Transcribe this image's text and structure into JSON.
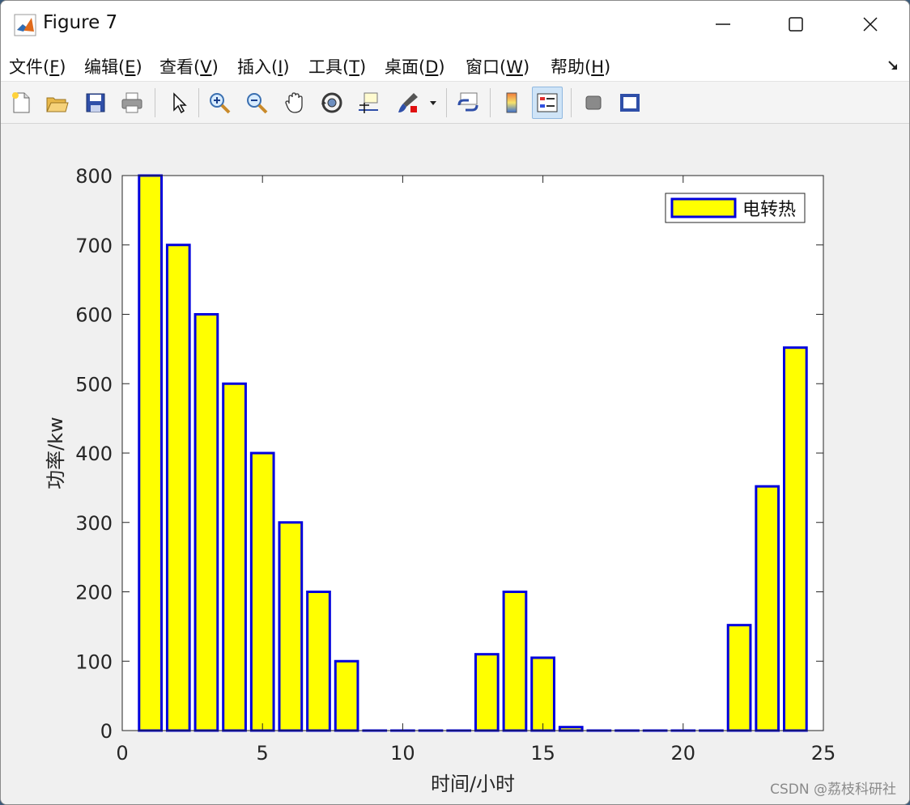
{
  "window": {
    "title": "Figure 7"
  },
  "menu": [
    {
      "pre": "文件(",
      "key": "F",
      "post": ")"
    },
    {
      "pre": "编辑(",
      "key": "E",
      "post": ")"
    },
    {
      "pre": "查看(",
      "key": "V",
      "post": ")"
    },
    {
      "pre": "插入(",
      "key": "I",
      "post": ")"
    },
    {
      "pre": "工具(",
      "key": "T",
      "post": ")"
    },
    {
      "pre": "桌面(",
      "key": "D",
      "post": ")"
    },
    {
      "pre": "窗口(",
      "key": "W",
      "post": ")"
    },
    {
      "pre": "帮助(",
      "key": "H",
      "post": ")"
    }
  ],
  "toolbar_icons": [
    "new-figure-icon",
    "open-file-icon",
    "save-icon",
    "print-icon",
    "pointer-icon",
    "zoom-in-icon",
    "zoom-out-icon",
    "pan-hand-icon",
    "rotate-3d-icon",
    "data-cursor-icon",
    "brush-icon",
    "link-plot-icon",
    "colorbar-icon",
    "legend-icon",
    "hide-tools-icon",
    "show-tools-icon"
  ],
  "chart_data": {
    "type": "bar",
    "title": "",
    "xlabel": "时间/小时",
    "ylabel": "功率/kw",
    "xlim": [
      0,
      25
    ],
    "ylim": [
      0,
      800
    ],
    "xticks": [
      0,
      5,
      10,
      15,
      20,
      25
    ],
    "yticks": [
      0,
      100,
      200,
      300,
      400,
      500,
      600,
      700,
      800
    ],
    "x": [
      1,
      2,
      3,
      4,
      5,
      6,
      7,
      8,
      9,
      10,
      11,
      12,
      13,
      14,
      15,
      16,
      17,
      18,
      19,
      20,
      21,
      22,
      23,
      24
    ],
    "series": [
      {
        "name": "电转热",
        "values": [
          800,
          700,
          600,
          500,
          400,
          300,
          200,
          100,
          0,
          0,
          0,
          0,
          110,
          200,
          105,
          5,
          0,
          0,
          0,
          0,
          0,
          152,
          352,
          552
        ]
      }
    ],
    "face_color": "#ffff00",
    "edge_color": "#0000dd",
    "grid": false,
    "legend": "top-right"
  },
  "watermark": "CSDN @荔枝科研社"
}
